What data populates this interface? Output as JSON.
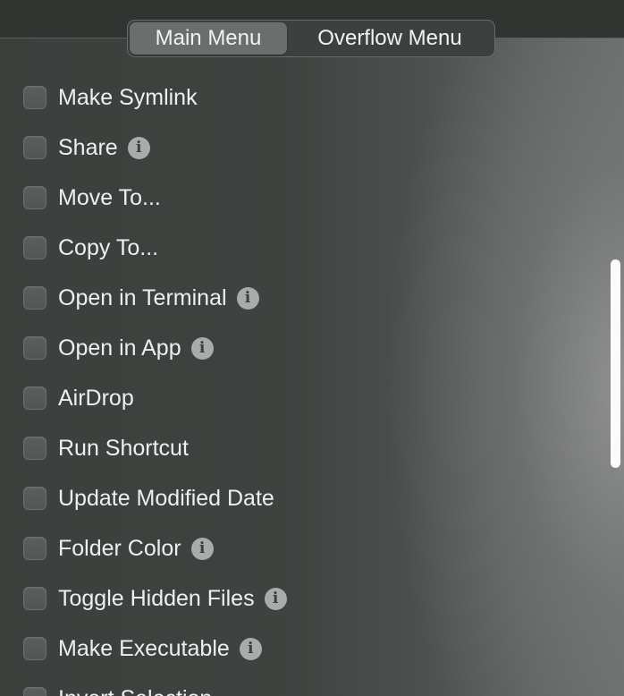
{
  "tabs": {
    "main": "Main Menu",
    "overflow": "Overflow Menu"
  },
  "items": [
    {
      "label": "Make Symlink",
      "checked": false,
      "info": false
    },
    {
      "label": "Share",
      "checked": false,
      "info": true
    },
    {
      "label": "Move To...",
      "checked": false,
      "info": false
    },
    {
      "label": "Copy To...",
      "checked": false,
      "info": false
    },
    {
      "label": "Open in Terminal",
      "checked": false,
      "info": true
    },
    {
      "label": "Open in App",
      "checked": false,
      "info": true
    },
    {
      "label": "AirDrop",
      "checked": false,
      "info": false
    },
    {
      "label": "Run Shortcut",
      "checked": false,
      "info": false
    },
    {
      "label": "Update Modified Date",
      "checked": false,
      "info": false
    },
    {
      "label": "Folder Color",
      "checked": false,
      "info": true
    },
    {
      "label": "Toggle Hidden Files",
      "checked": false,
      "info": true
    },
    {
      "label": "Make Executable",
      "checked": false,
      "info": true
    },
    {
      "label": "Invert Selection",
      "checked": false,
      "info": false
    }
  ],
  "info_glyph": "i",
  "icons": {
    "info": "info-circle-icon"
  }
}
